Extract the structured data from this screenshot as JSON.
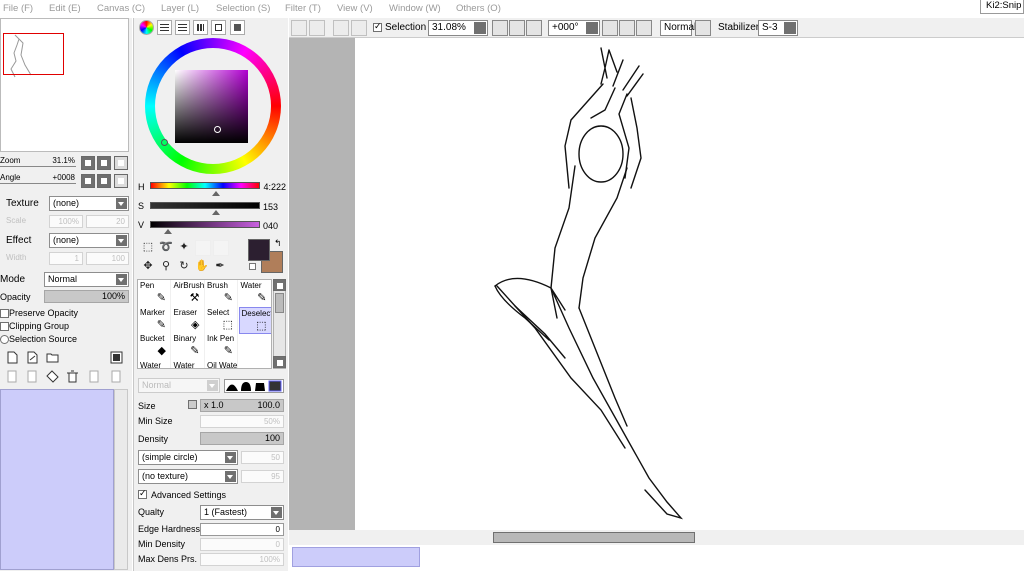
{
  "menubar": {
    "items": [
      "File (F)",
      "Edit (E)",
      "Canvas (C)",
      "Layer (L)",
      "Selection (S)",
      "Filter (T)",
      "View (V)",
      "Window (W)",
      "Others (O)"
    ],
    "right_tab": "Ki2:Snip"
  },
  "navigator": {
    "zoom_label": "Zoom",
    "zoom_value": "31.1%",
    "angle_label": "Angle",
    "angle_value": "+0008"
  },
  "layer_panel": {
    "texture_label": "Texture",
    "texture_value": "(none)",
    "scale_label": "Scale",
    "scale_value": "100%",
    "scale_num": "20",
    "effect_label": "Effect",
    "effect_value": "(none)",
    "width_label": "Width",
    "width_value": "1",
    "width_num": "100",
    "mode_label": "Mode",
    "mode_value": "Normal",
    "opacity_label": "Opacity",
    "opacity_value": "100%",
    "checkboxes": [
      "Preserve Opacity",
      "Clipping Group",
      "Selection Source"
    ]
  },
  "color": {
    "h_label": "H",
    "h_value": "4:222",
    "s_label": "S",
    "s_value": "153",
    "v_label": "V",
    "v_value": "040",
    "h_fraction": 0.6,
    "s_fraction": 0.6,
    "v_fraction": 0.16,
    "primary": "#2c1f30",
    "secondary": "#b07e5a"
  },
  "brushes": {
    "cells": [
      {
        "name": "Pen",
        "glyph": "✎"
      },
      {
        "name": "AirBrush",
        "glyph": "⚒"
      },
      {
        "name": "Brush",
        "glyph": "✎"
      },
      {
        "name": "Water",
        "glyph": "✎"
      },
      {
        "name": "Marker",
        "glyph": "✎"
      },
      {
        "name": "Eraser",
        "glyph": "◈"
      },
      {
        "name": "Select",
        "glyph": "⬚"
      },
      {
        "name": "Deselect",
        "glyph": "⬚"
      },
      {
        "name": "Bucket",
        "glyph": "◆"
      },
      {
        "name": "Binary",
        "glyph": "✎"
      },
      {
        "name": "Ink Pen",
        "glyph": "✎"
      },
      {
        "name": "",
        "glyph": ""
      },
      {
        "name": "Water",
        "glyph": ""
      },
      {
        "name": "Water",
        "glyph": ""
      },
      {
        "name": "Oil Wate",
        "glyph": ""
      },
      {
        "name": "",
        "glyph": ""
      }
    ],
    "selected_index": 7
  },
  "brush_settings": {
    "blend_mode": "Normal",
    "size_label": "Size",
    "size_mult": "x 1.0",
    "size_value": "100.0",
    "min_size_label": "Min Size",
    "min_size_value": "50%",
    "density_label": "Density",
    "density_value": "100",
    "shape_value": "(simple circle)",
    "shape_num": "50",
    "texture_value": "(no texture)",
    "texture_num": "95",
    "advanced_label": "Advanced Settings",
    "quality_label": "Qualty",
    "quality_value": "1 (Fastest)",
    "edge_label": "Edge Hardness",
    "edge_value": "0",
    "min_dens_label": "Min Density",
    "min_dens_value": "0",
    "max_dens_label": "Max Dens Prs.",
    "max_dens_value": "100%"
  },
  "canvas_toolbar": {
    "selection_label": "Selection",
    "zoom_value": "31.08%",
    "rotation_value": "+000°",
    "blend_value": "Normal",
    "stabilizer_label": "Stabilizer",
    "stabilizer_value": "S-3"
  },
  "scroll": {
    "horizontal_position": 0.28
  }
}
